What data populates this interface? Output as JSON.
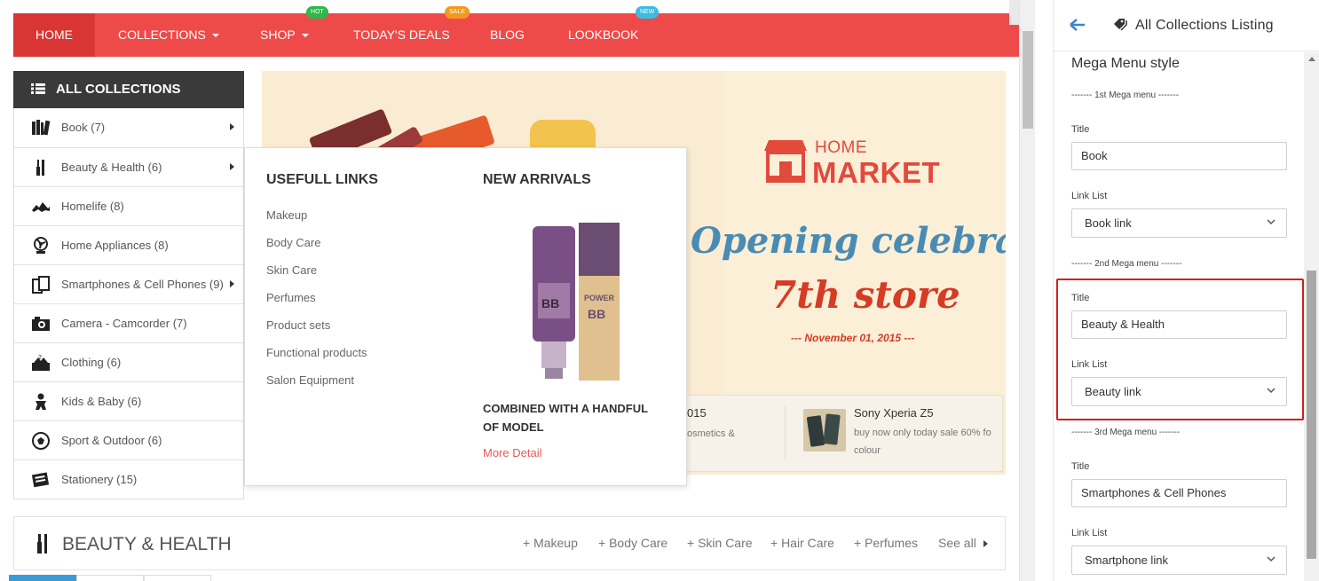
{
  "nav": {
    "items": [
      {
        "label": "HOME",
        "caret": false,
        "badge": ""
      },
      {
        "label": "COLLECTIONS",
        "caret": true,
        "badge": ""
      },
      {
        "label": "SHOP",
        "caret": true,
        "badge": "HOT"
      },
      {
        "label": "TODAY'S DEALS",
        "caret": false,
        "badge": "SALE"
      },
      {
        "label": "BLOG",
        "caret": false,
        "badge": ""
      },
      {
        "label": "LOOKBOOK",
        "caret": false,
        "badge": "NEW"
      }
    ],
    "badge_colors": {
      "HOT": "#2fb74a",
      "SALE": "#f39a1d",
      "NEW": "#3dbbe0"
    },
    "accent": "#ef4a4a"
  },
  "collections": {
    "header": "ALL COLLECTIONS",
    "items": [
      {
        "label": "Book (7)",
        "icon": "book-icon",
        "has_sub": true
      },
      {
        "label": "Beauty & Health (6)",
        "icon": "beauty-icon",
        "has_sub": true
      },
      {
        "label": "Homelife (8)",
        "icon": "homelife-icon",
        "has_sub": false
      },
      {
        "label": "Home Appliances (8)",
        "icon": "fan-icon",
        "has_sub": false
      },
      {
        "label": "Smartphones & Cell Phones (9)",
        "icon": "phone-icon",
        "has_sub": true
      },
      {
        "label": "Camera - Camcorder (7)",
        "icon": "camera-icon",
        "has_sub": false
      },
      {
        "label": "Clothing (6)",
        "icon": "clothing-icon",
        "has_sub": false
      },
      {
        "label": "Kids & Baby (6)",
        "icon": "baby-icon",
        "has_sub": false
      },
      {
        "label": "Sport & Outdoor (6)",
        "icon": "ball-icon",
        "has_sub": false
      },
      {
        "label": "Stationery (15)",
        "icon": "stationery-icon",
        "has_sub": false
      }
    ]
  },
  "mega_menu": {
    "col1_title": "USEFULL LINKS",
    "links": [
      "Makeup",
      "Body Care",
      "Skin Care",
      "Perfumes",
      "Product sets",
      "Functional products",
      "Salon Equipment"
    ],
    "col2_title": "NEW ARRIVALS",
    "product_name": "COMBINED WITH A HANDFUL OF MODEL",
    "more_label": "More Detail"
  },
  "banner": {
    "logo_home": "HOME",
    "logo_market": "MARKET",
    "headline": "Opening celebration",
    "subheadline": "7th store",
    "date": "--- November 01, 2015 ---",
    "promo1": {
      "title": "015",
      "desc": "osmetics &"
    },
    "promo2": {
      "title": "Sony Xperia Z5",
      "desc": "buy now only today sale 60% fo colour"
    }
  },
  "beauty_section": {
    "title": "BEAUTY & HEALTH",
    "links": [
      "+ Makeup",
      "+ Body Care",
      "+ Skin Care",
      "+ Hair Care",
      "+ Perfumes"
    ],
    "see_all": "See all"
  },
  "panel": {
    "title": "All Collections Listing",
    "section_title": "Mega Menu style",
    "menus": [
      {
        "divider": "------- 1st Mega menu -------",
        "title_label": "Title",
        "title_value": "Book",
        "link_label": "Link List",
        "link_value": "Book link"
      },
      {
        "divider": "------- 2nd Mega menu -------",
        "title_label": "Title",
        "title_value": "Beauty & Health",
        "link_label": "Link List",
        "link_value": "Beauty link"
      },
      {
        "divider": "------- 3rd Mega menu -------",
        "title_label": "Title",
        "title_value": "Smartphones & Cell Phones",
        "link_label": "Link List",
        "link_value": "Smartphone link"
      }
    ],
    "highlight_color": "#d11f1f"
  }
}
